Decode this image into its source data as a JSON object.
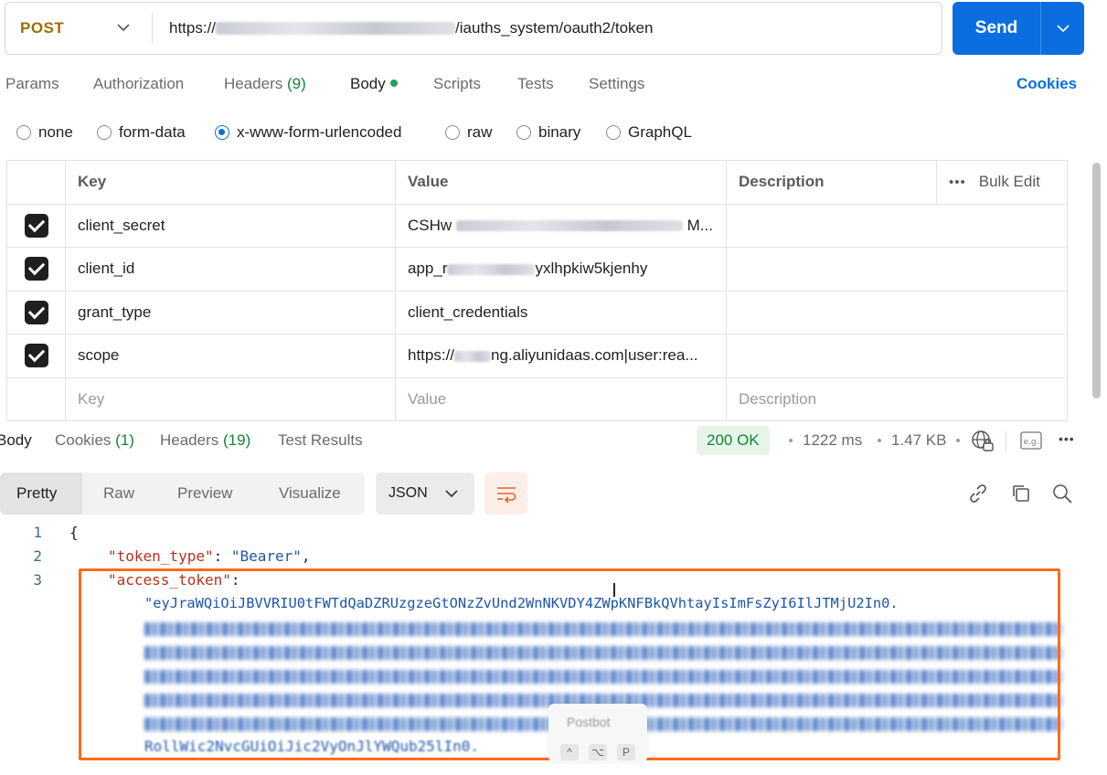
{
  "request": {
    "method": "POST",
    "url_prefix": "https://",
    "url_suffix": "/iauths_system/oauth2/token",
    "send_label": "Send"
  },
  "request_tabs": [
    {
      "label": "Params"
    },
    {
      "label": "Authorization"
    },
    {
      "label": "Headers",
      "count": "(9)"
    },
    {
      "label": "Body",
      "active": true
    },
    {
      "label": "Scripts"
    },
    {
      "label": "Tests"
    },
    {
      "label": "Settings"
    }
  ],
  "cookies_link": "Cookies",
  "body_types": [
    {
      "label": "none"
    },
    {
      "label": "form-data"
    },
    {
      "label": "x-www-form-urlencoded",
      "selected": true
    },
    {
      "label": "raw"
    },
    {
      "label": "binary"
    },
    {
      "label": "GraphQL"
    }
  ],
  "params_table": {
    "headers": {
      "key": "Key",
      "value": "Value",
      "description": "Description",
      "bulk_edit": "Bulk Edit"
    },
    "rows": [
      {
        "key": "client_secret",
        "value_visible_start": "CSHw",
        "value_visible_end": "M...",
        "checked": true
      },
      {
        "key": "client_id",
        "value_visible_start": "app_r",
        "value_visible_end": "yxlhpkiw5kjenhy",
        "checked": true
      },
      {
        "key": "grant_type",
        "value": "client_credentials",
        "checked": true
      },
      {
        "key": "scope",
        "value_visible_start": "https://",
        "value_visible_end": "ng.aliyunidaas.com|user:rea...",
        "checked": true
      }
    ],
    "placeholders": {
      "key": "Key",
      "value": "Value",
      "description": "Description"
    }
  },
  "response_tabs": [
    {
      "label": "Body",
      "active": true
    },
    {
      "label": "Cookies",
      "count": "(1)"
    },
    {
      "label": "Headers",
      "count": "(19)"
    },
    {
      "label": "Test Results"
    }
  ],
  "response_meta": {
    "status": "200 OK",
    "time": "1222 ms",
    "size": "1.47 KB",
    "status_color": "#16833a"
  },
  "view_modes": [
    {
      "label": "Pretty",
      "active": true
    },
    {
      "label": "Raw"
    },
    {
      "label": "Preview"
    },
    {
      "label": "Visualize"
    }
  ],
  "format": "JSON",
  "code": {
    "line_numbers": [
      "1",
      "2",
      "3"
    ],
    "open_brace": "{",
    "token_type_key": "\"token_type\"",
    "token_type_value": "\"Bearer\"",
    "access_token_key": "\"access_token\"",
    "access_token_first_line": "\"eyJraWQiOiJBVVRIU0tFWTdQaDZRUzgzeGtONzZvUnd2WnNKVDY4ZWpKNFBkQVhtayIsImFsZyI6IlJTMjU2In0.",
    "access_token_last_line": "RollWic2NvcGUiOiJic2VyOnJlYWQub25lIn0."
  },
  "popup": {
    "title": "Postbot",
    "keys": [
      "^",
      "⌥",
      "P"
    ]
  }
}
